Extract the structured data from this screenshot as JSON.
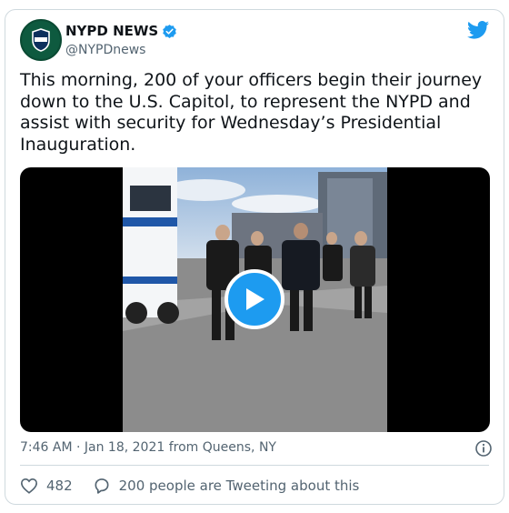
{
  "tweet": {
    "display_name": "NYPD NEWS",
    "handle": "@NYPDnews",
    "verified_icon": "verified-badge-icon",
    "logo_icon": "twitter-bird-icon",
    "text": "This morning, 200 of your officers begin their journey down to the U.S. Capitol, to represent the NYPD and assist with security for Wednesday’s Presidential Inauguration.",
    "timestamp": "7:46 AM · Jan 18, 2021 from Queens, NY",
    "likes_count": "482",
    "retweet_text": "200 people are Tweeting about this"
  },
  "colors": {
    "brand": "#1d9bf0",
    "text": "#0f1419",
    "muted": "#536471",
    "border": "#cfd9de"
  }
}
